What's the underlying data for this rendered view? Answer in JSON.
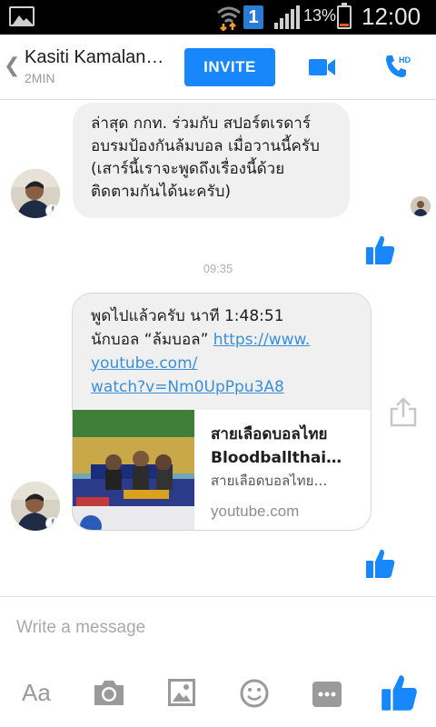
{
  "status_bar": {
    "notification_count": "1",
    "battery_percent": "13%",
    "time": "12:00",
    "battery_level": 0.13
  },
  "header": {
    "contact_name": "Kasiti Kamalan…",
    "status": "2MIN",
    "invite_label": "INVITE",
    "accent_color": "#1787fb"
  },
  "messages": {
    "first": {
      "lines": [
        "ล่าสุด กกท. ร่วมกับ สปอร์ตเรดาร์",
        "อบรมป้องกันล้มบอล เมื่อวานนี้ครับ",
        "(เสาร์นี้เราจะพูดถึงเรื่องนี้ด้วย",
        "ติดตามกันได้นะครับ)"
      ]
    },
    "timestamp": "09:35",
    "second": {
      "line1": "พูดไปแล้วครับ นาที 1:48:51",
      "line2_prefix": "นักบอล “ล้มบอล” ",
      "link_part1": "https://www.",
      "link_part2": "youtube.com/",
      "link_part3": "watch?v=Nm0UpPpu3A8",
      "preview_title1": "สายเลือดบอลไทย",
      "preview_title2": "Bloodballthai…",
      "preview_desc": "สายเลือดบอลไทย…",
      "preview_domain": "youtube.com"
    }
  },
  "composer": {
    "placeholder": "Write a message",
    "aa_label": "Aa"
  },
  "icons": {
    "camera": "camera-icon",
    "gallery": "image-icon",
    "emoji": "smiley-icon",
    "more": "more-icon",
    "like": "thumbs-up-icon",
    "video": "video-call-icon",
    "phone": "phone-hd-icon",
    "share": "share-icon"
  }
}
